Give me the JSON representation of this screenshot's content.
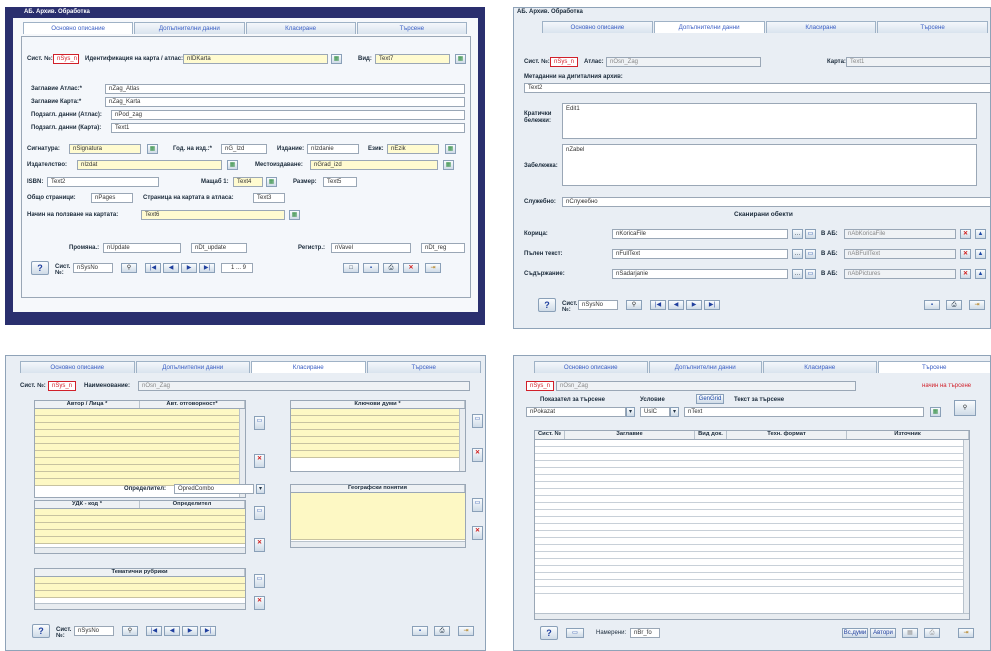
{
  "p1": {
    "title": "АБ. Архив. Обработка",
    "tabs": [
      "Основно описание",
      "Допълнителни данни",
      "Класиране",
      "Търсене"
    ],
    "sist_label": "Сист. №:",
    "sist_val": "nSys_n",
    "ident_label": "Идентификация на карта / атлас:",
    "ident_val": "nIDKarta",
    "vid_label": "Вид:",
    "vid_val": "Text7",
    "zag_atlas_label": "Заглавие Атлас:*",
    "zag_atlas_val": "nZag_Atlas",
    "zag_karta_label": "Заглавие Карта:*",
    "zag_karta_val": "nZag_Karta",
    "podz_atlas_label": "Подзагл. данни (Атлас):",
    "podz_atlas_val": "nPod_zag",
    "podz_karta_label": "Подзагл. данни (Карта):",
    "podz_karta_val": "Text1",
    "sign_label": "Сигнатура:",
    "sign_val": "nSignatura",
    "god_label": "Год. на изд.:*",
    "god_val": "nG_Izd",
    "izd_label": "Издание:",
    "izd_val": "nIzdanie",
    "ezik_label": "Език:",
    "ezik_val": "nEzik",
    "izdatel_label": "Издателство:",
    "izdatel_val": "nIzdat",
    "mesto_label": "Местоиздаване:",
    "mesto_val": "nGrad_izd",
    "isbn_label": "ISBN:",
    "isbn_val": "Text2",
    "mashtab_label": "Мащаб 1:",
    "mashtab_val": "Text4",
    "razmer_label": "Размер:",
    "razmer_val": "Text5",
    "obshto_label": "Общо страници:",
    "obshto_val": "nPages",
    "stranica_label": "Страница на картата в атласа:",
    "stranica_val": "Text3",
    "nachin_label": "Начин на ползване на картата:",
    "nachin_val": "Text6",
    "promqna_label": "Промяна.:",
    "promqna_val": "nUpdate",
    "dt_update": "nDt_update",
    "registr_label": "Регистр.:",
    "registr_val": "nVavel",
    "dt_reg": "nDt_reg",
    "sist_bottom_label": "Сист. №:",
    "sist_bottom_val": "nSysNo",
    "counter": "1 ... 9"
  },
  "p2": {
    "title": "АБ. Архив. Обработка",
    "tabs": [
      "Основно описание",
      "Допълнителни данни",
      "Класиране",
      "Търсене"
    ],
    "sist_label": "Сист. №:",
    "sist_val": "nSys_n",
    "atlas_label": "Атлас:",
    "atlas_val": "nOsn_Zag",
    "karta_label": "Карта:",
    "karta_val": "Text1",
    "meta_label": "Метаданни на дигиталния архив:",
    "meta_val": "Text2",
    "kratki_label": "Кратички бележки:",
    "kratki_val": "Edit1",
    "zabel_label": "Забележка:",
    "zabel_val": "nZabel",
    "sluj_label": "Служебно:",
    "sluj_val": "nСлужебно",
    "skan_label": "Сканирани обекти",
    "korica_label": "Корица:",
    "korica_val": "nKoricaFile",
    "korica_ab_label": "В АБ:",
    "korica_ab_val": "nAbKoricaFile",
    "pulen_label": "Пълен текст:",
    "pulen_val": "nFullText",
    "pulen_ab_label": "В АБ:",
    "pulen_ab_val": "nABFullText",
    "sudurj_label": "Съдържание:",
    "sudurj_val": "nSadarjanie",
    "sudurj_ab_label": "В АБ:",
    "sudurj_ab_val": "nAbPictures",
    "sist_bottom_label": "Сист. №:",
    "sist_bottom_val": "nSysNo"
  },
  "p3": {
    "tabs": [
      "Основно описание",
      "Допълнителни данни",
      "Класиране",
      "Търсене"
    ],
    "sist_label": "Сист. №:",
    "sist_val": "nSys_n",
    "naim_label": "Наименование:",
    "naim_val": "nOsn_Zag",
    "avtor_col": "Автор / Лица *",
    "avt_col": "Авт. отговорност*",
    "klyuch_col": "Ключови думи *",
    "opred_label": "Определител:",
    "opred_val": "OpredCombo",
    "udk_col": "УДК - код *",
    "opred_col": "Определител",
    "geo_col": "Географски понятия",
    "temat_col": "Тематични рубрики",
    "sist_bottom_label": "Сист. №:",
    "sist_bottom_val": "nSysNo"
  },
  "p4": {
    "tabs": [
      "Основно описание",
      "Допълнителни данни",
      "Класиране",
      "Търсене"
    ],
    "sist_val": "nSys_n",
    "naim_val": "nOsn_Zag",
    "nachin_search": "начин на търсене",
    "pokaz_label": "Показател за търсене",
    "uslovie_label": "Условие",
    "gengrid": "GenGrid",
    "tekst_label": "Текст за търсене",
    "pokaz_val": "nPokazat",
    "uslovie_val": "UslC",
    "tekst_val": "nText",
    "cols": [
      "Сист. №",
      "Заглавие",
      "Вид док.",
      "Техн. формат",
      "Източник"
    ],
    "namereni_label": "Намерени:",
    "namereni_val": "nBr_fo",
    "btn_vsichki": "Вс.думи",
    "btn_avtori": "Автори"
  }
}
